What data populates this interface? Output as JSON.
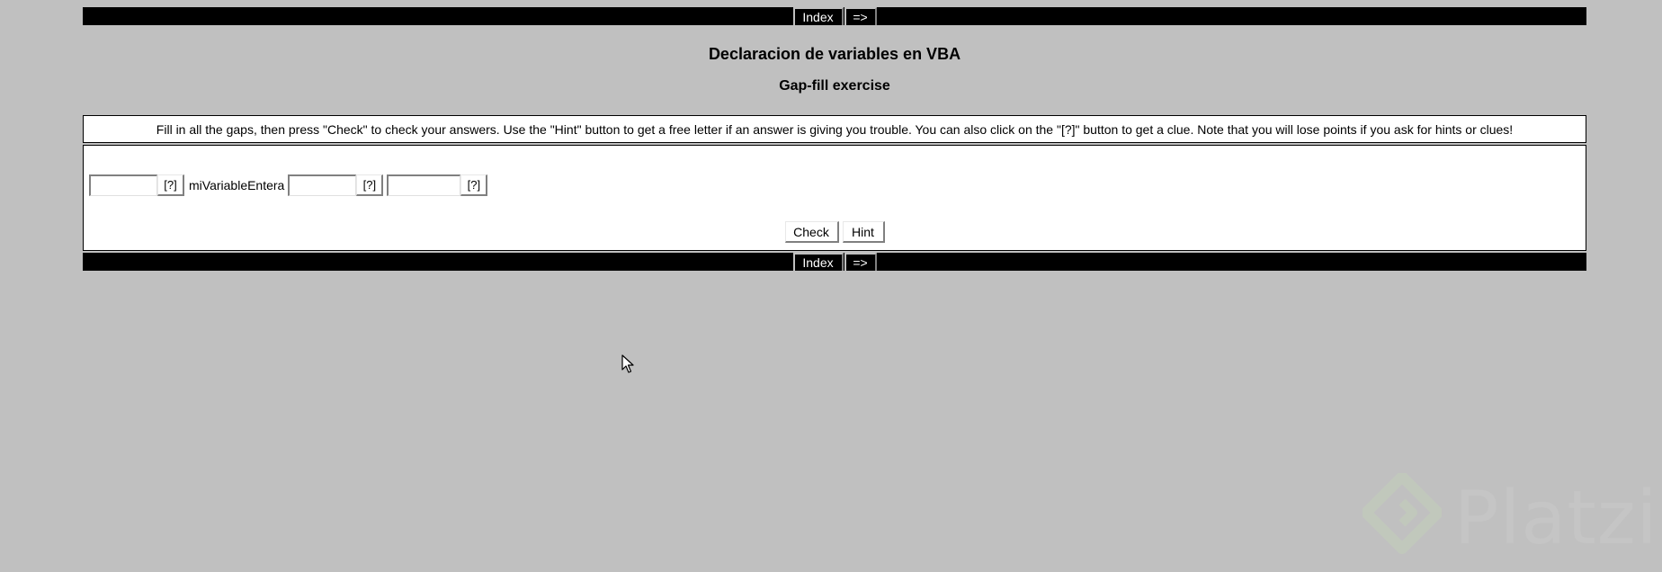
{
  "nav_top": {
    "index_label": "Index",
    "next_label": "=>"
  },
  "title": "Declaracion de variables en VBA",
  "subtitle": "Gap-fill exercise",
  "instructions": "Fill in all the gaps, then press \"Check\" to check your answers. Use the \"Hint\" button to get a free letter if an answer is giving you trouble. You can also click on the \"[?]\" button to get a clue. Note that you will lose points if you ask for hints or clues!",
  "exercise": {
    "gap1_value": "",
    "clue_label": "[?]",
    "text_between": "miVariableEntera",
    "gap2_value": "",
    "gap3_value": "",
    "check_label": "Check",
    "hint_label": "Hint"
  },
  "nav_bottom": {
    "index_label": "Index",
    "next_label": "=>"
  },
  "watermark": "Platzi"
}
